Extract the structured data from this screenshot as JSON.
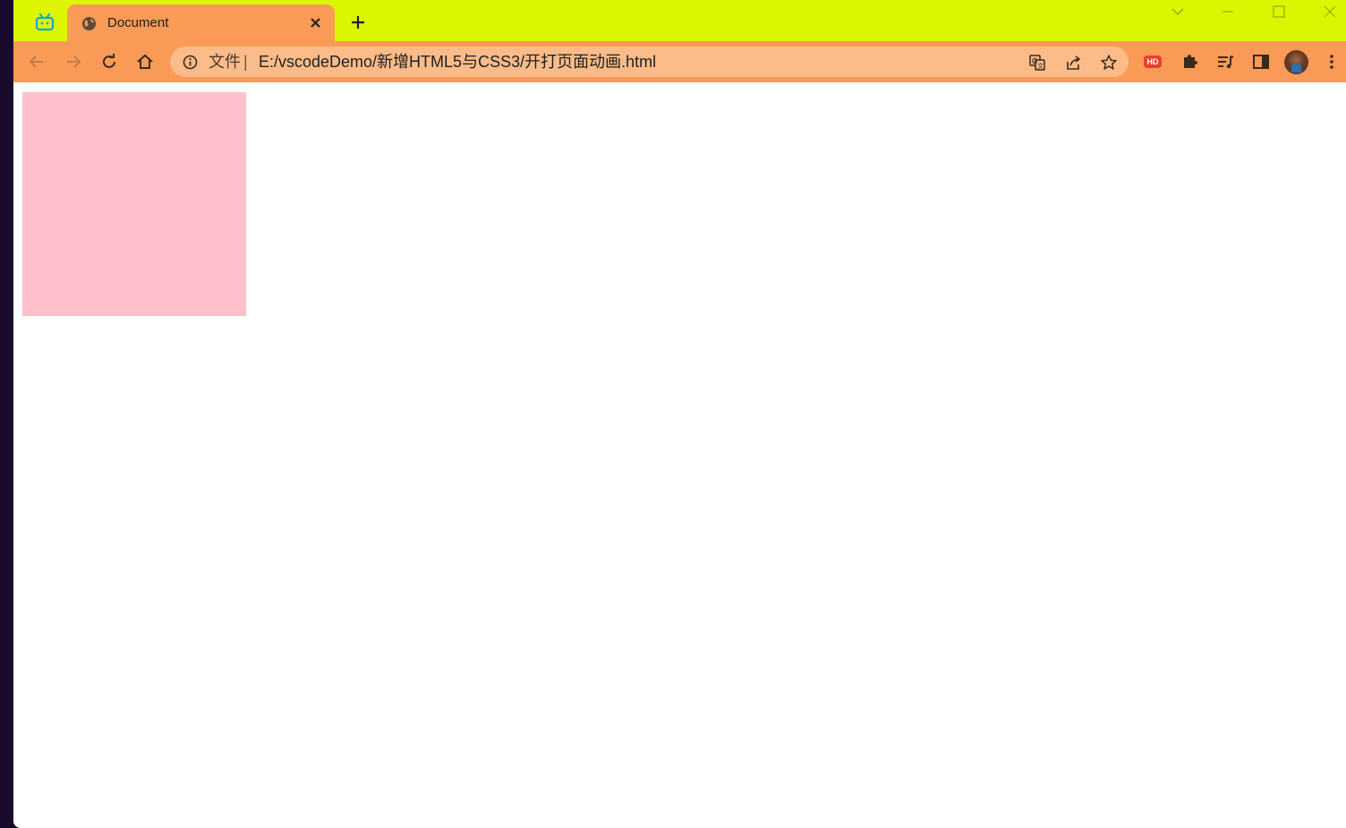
{
  "browser": {
    "tab": {
      "title": "Document",
      "favicon": "globe-icon"
    },
    "address_bar": {
      "scheme_label": "文件",
      "separator": "|",
      "url": "E:/vscodeDemo/新增HTML5与CSS3/开打页面动画.html"
    },
    "extensions": {
      "hd_badge": "HD"
    }
  },
  "colors": {
    "tabstrip": "#dcf500",
    "toolbar": "#f99b56",
    "omnibox": "#fbbc8a",
    "box": "#ffc0cb"
  },
  "page": {
    "box_color": "#ffc0cb"
  }
}
